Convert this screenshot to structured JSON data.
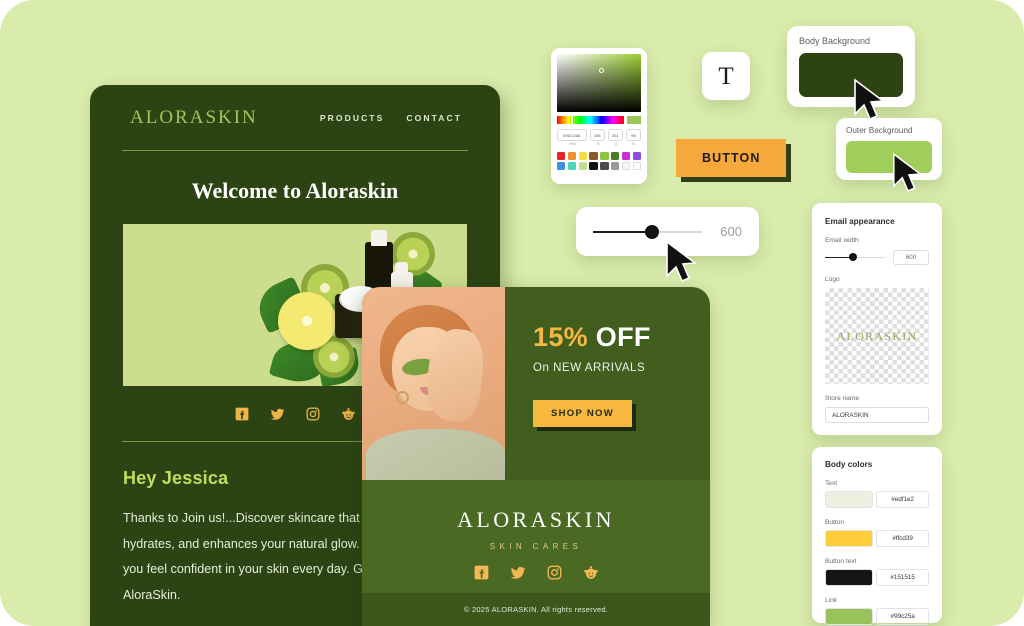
{
  "canvas": {
    "background": "#d9ecac"
  },
  "desktop_preview": {
    "logo": "ALORASKIN",
    "nav": [
      {
        "label": "PRODUCTS"
      },
      {
        "label": "CONTACT"
      }
    ],
    "welcome_heading": "Welcome to Aloraskin",
    "hero_alt": "kiwi-lemon-cosmetics-flatlay-image",
    "social_icons": [
      "facebook-icon",
      "twitter-icon",
      "instagram-icon",
      "reddit-icon"
    ],
    "greeting": "Hey Jessica",
    "body_text": "Thanks to Join us!...Discover skincare that nourishes, hydrates, and enhances your natural glow. We're here to help you feel confident in your skin every day. Glow with AloraSkin."
  },
  "mobile_preview": {
    "photo_alt": "woman-with-green-eye-patches-image",
    "offer_percent": "15%",
    "offer_word": "OFF",
    "offer_sub": "On NEW ARRIVALS",
    "shop_button": "SHOP NOW",
    "brand": "ALORASKIN",
    "tagline": "SKIN CARES",
    "social_icons": [
      "facebook-icon",
      "twitter-icon",
      "instagram-icon",
      "reddit-icon"
    ],
    "copyright": "© 2025 ALORASKIN. All rights reserved."
  },
  "color_picker": {
    "hex_value": "#9DC45A",
    "r_value": "155",
    "g_value": "201",
    "b_value": "96",
    "labels": {
      "hex": "Hex",
      "r": "R",
      "g": "G",
      "b": "B"
    },
    "current_swatch": "#9dc45a",
    "swatches": [
      "#e0262c",
      "#f0902f",
      "#f5dd3c",
      "#8a5a2b",
      "#8cc63f",
      "#4a7c22",
      "#cc2fd0",
      "#8a4fe0",
      "#3f8fe0",
      "#4ad6b8",
      "#bfe08a",
      "#111111",
      "#4a4a4a",
      "#9a9a9a",
      "#f5f5f5",
      "#ffffff"
    ]
  },
  "text_tool": {
    "glyph_label": "T",
    "name": "text-tool"
  },
  "button_widget": {
    "label": "BUTTON",
    "fill": "#f7a83c"
  },
  "slider_widget": {
    "value": "600",
    "fill": "#1c1c1c"
  },
  "body_background_card": {
    "label": "Body Background",
    "color": "#2d4312"
  },
  "outer_background_card": {
    "label": "Outer Background",
    "color": "#9fce5b"
  },
  "panel_appearance": {
    "title": "Email appearance",
    "email_width_label": "Email width",
    "email_width_value": "600",
    "logo_label": "Logo",
    "logo_text": "ALORASKIN",
    "store_name_label": "Store name",
    "store_name_value": "ALORASKIN"
  },
  "panel_colors": {
    "title": "Body colors",
    "rows": [
      {
        "label": "Text",
        "hex": "#edf1e2",
        "swatch": "#edf1e2"
      },
      {
        "label": "Button",
        "hex": "#ffcd39",
        "swatch": "#ffcd39"
      },
      {
        "label": "Button text",
        "hex": "#151515",
        "swatch": "#151515"
      },
      {
        "label": "Link",
        "hex": "#99c25a",
        "swatch": "#99c25a"
      }
    ]
  },
  "cursors": [
    {
      "name": "cursor-body-background"
    },
    {
      "name": "cursor-outer-background"
    },
    {
      "name": "cursor-slider"
    }
  ]
}
